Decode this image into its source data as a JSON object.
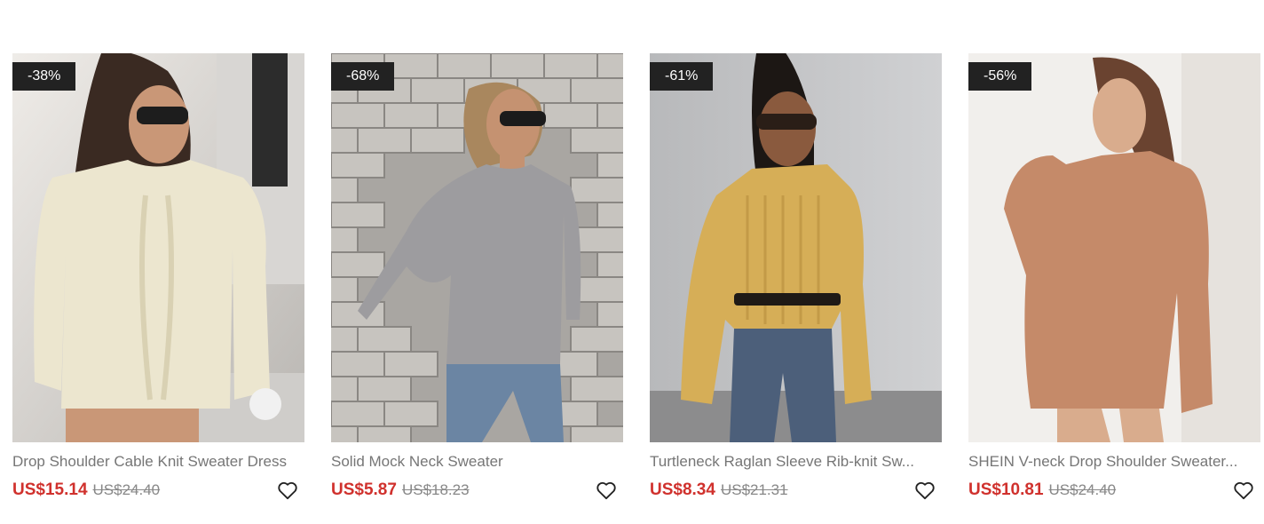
{
  "products": [
    {
      "discount": "-38%",
      "title": "Drop Shoulder Cable Knit Sweater Dress",
      "price": "US$15.14",
      "original_price": "US$24.40",
      "colors": {
        "bg1": "#e9e6e1",
        "bg2": "#b7b5b2",
        "garment": "#ece6cf",
        "hair": "#3a2a22",
        "skin": "#c99777"
      }
    },
    {
      "discount": "-68%",
      "title": "Solid Mock Neck Sweater",
      "price": "US$5.87",
      "original_price": "US$18.23",
      "colors": {
        "bg1": "#b9b6b2",
        "bg2": "#8e8b87",
        "garment": "#9d9c9f",
        "hair": "#a9875e",
        "skin": "#c59271",
        "jeans": "#6b85a3"
      }
    },
    {
      "discount": "-61%",
      "title": "Turtleneck Raglan Sleeve Rib-knit Sw...",
      "price": "US$8.34",
      "original_price": "US$21.31",
      "colors": {
        "bg1": "#c3c4c6",
        "bg2": "#9b9c9f",
        "garment": "#d6ae57",
        "hair": "#1c1714",
        "skin": "#8a5a3e",
        "jeans": "#4c5f7a"
      }
    },
    {
      "discount": "-56%",
      "title": "SHEIN V-neck Drop Shoulder Sweater...",
      "price": "US$10.81",
      "original_price": "US$24.40",
      "colors": {
        "bg1": "#f3f1ee",
        "bg2": "#e3dfda",
        "garment": "#c58a69",
        "hair": "#6a4330",
        "skin": "#d9ac8d"
      }
    }
  ]
}
